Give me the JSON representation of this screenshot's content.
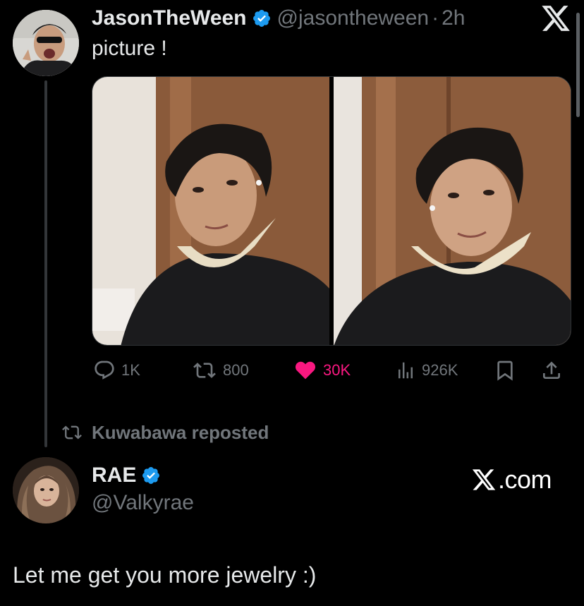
{
  "post": {
    "author_name": "JasonTheWeen",
    "author_handle": "@jasontheween",
    "separator": "·",
    "time_ago": "2h",
    "text": "picture !",
    "verified_icon": "verified-badge-icon",
    "media": [
      {
        "description": "photo-1",
        "icon": "photo-icon"
      },
      {
        "description": "photo-2",
        "icon": "photo-icon"
      }
    ],
    "stats": {
      "replies": "1K",
      "reposts": "800",
      "likes": "30K",
      "views": "926K"
    },
    "liked": true
  },
  "repost_banner": {
    "text": "Kuwabawa reposted"
  },
  "quoted_user": {
    "name": "RAE",
    "handle": "@Valkyrae",
    "reply_text": "Let me get you more jewelry :)"
  },
  "watermark": {
    "text": ".com",
    "logo": "x-logo-icon"
  },
  "colors": {
    "background": "#000000",
    "text_primary": "#e7e9ea",
    "text_secondary": "#71767b",
    "like_pink": "#f91880",
    "verified_blue": "#1d9bf0",
    "thread_line": "#333639"
  }
}
